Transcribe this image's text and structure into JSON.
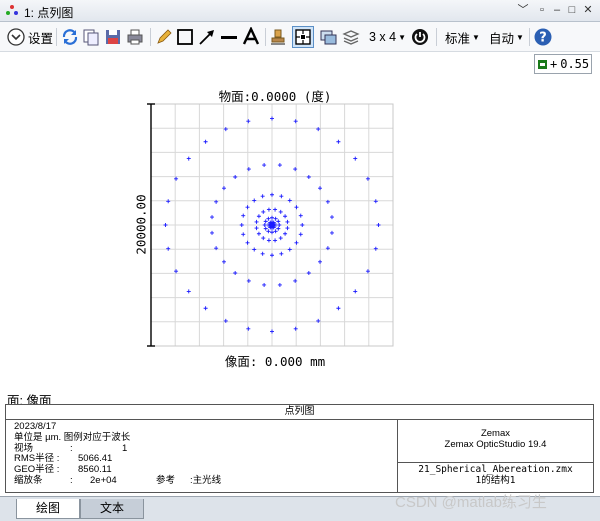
{
  "window": {
    "title": "1: 点列图",
    "controls": [
      "﹀",
      "▫",
      "–",
      "□",
      "✕"
    ]
  },
  "toolbar": {
    "settings_label": "设置",
    "layout_label": "3 x 4",
    "standard_label": "标准",
    "auto_label": "自动"
  },
  "zoom_value": "0.55",
  "plot": {
    "title": "物面:0.0000 (度)",
    "xlabel": "像面: 0.000 mm",
    "scale_label": "20000.00"
  },
  "surface_label": "面: 像面",
  "chart_data": {
    "type": "scatter",
    "title": "物面:0.0000 (度)",
    "xlabel": "像面: 0.000 mm",
    "ylabel": "20000.00",
    "xlim": [
      -10000,
      10000
    ],
    "ylim": [
      -10000,
      10000
    ],
    "grid": true,
    "legend": "none",
    "series_color": "#1a1aff",
    "rings": [
      {
        "radius": 8800,
        "points": 28
      },
      {
        "radius": 5000,
        "points": 24
      },
      {
        "radius": 2500,
        "points": 20
      },
      {
        "radius": 1300,
        "points": 16
      },
      {
        "radius": 600,
        "points": 12
      },
      {
        "radius": 250,
        "points": 10
      }
    ]
  },
  "info": {
    "header": "点列图",
    "date": "2023/8/17",
    "units_line": "单位是 µm. 图例对应于波长",
    "field_key": "视场",
    "field_value": "1",
    "rms_key": "RMS半径 :",
    "rms_value": "5066.41",
    "geo_key": "GEO半径 :",
    "geo_value": "8560.11",
    "scale_key": "缩放条",
    "scale_value": "2e+04",
    "ref_key": "参考",
    "ref_value": ":主光线",
    "colon": ":",
    "vendor": "Zemax",
    "product": "Zemax OpticStudio 19.4",
    "file": "21_Spherical_Abereation.zmx",
    "config": "1的结构1"
  },
  "tabs": [
    "绘图",
    "文本"
  ],
  "watermark": "CSDN @matlab练习生"
}
